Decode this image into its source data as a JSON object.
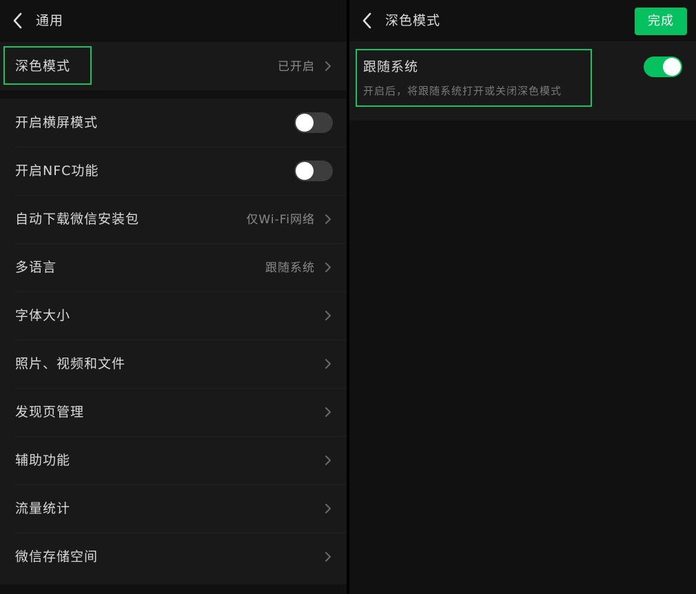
{
  "left": {
    "title": "通用",
    "dark_mode_row": {
      "label": "深色模式",
      "value": "已开启"
    },
    "rows": [
      {
        "label": "开启横屏模式",
        "toggle": "off"
      },
      {
        "label": "开启NFC功能",
        "toggle": "off"
      },
      {
        "label": "自动下载微信安装包",
        "value": "仅Wi-Fi网络"
      },
      {
        "label": "多语言",
        "value": "跟随系统"
      },
      {
        "label": "字体大小"
      },
      {
        "label": "照片、视频和文件"
      },
      {
        "label": "发现页管理"
      },
      {
        "label": "辅助功能"
      },
      {
        "label": "流量统计"
      },
      {
        "label": "微信存储空间"
      }
    ]
  },
  "right": {
    "title": "深色模式",
    "done_label": "完成",
    "follow_system": {
      "label": "跟随系统",
      "description": "开启后，将跟随系统打开或关闭深色模式",
      "toggle": "on"
    }
  },
  "colors": {
    "accent_green": "#07c160",
    "highlight_green": "#15c463",
    "background": "#111111",
    "cell_background": "#191919"
  },
  "icons": {
    "back": "chevron-left-icon",
    "disclosure": "chevron-right-icon"
  }
}
